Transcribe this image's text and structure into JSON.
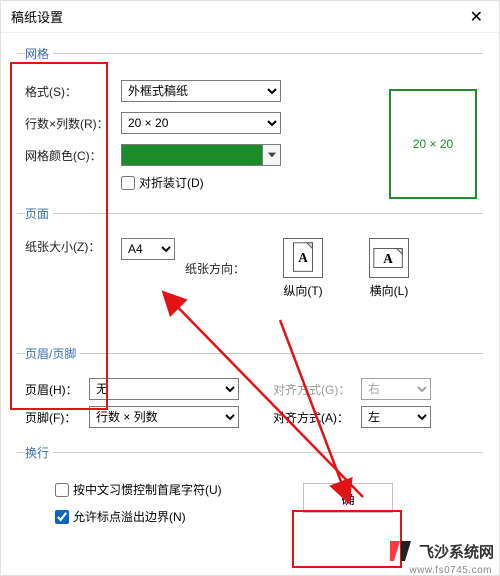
{
  "window": {
    "title": "稿纸设置",
    "close_icon_name": "close"
  },
  "groups": {
    "grid": "网格",
    "page": "页面",
    "header_footer": "页眉/页脚",
    "wrap": "换行"
  },
  "grid": {
    "format_label": "格式(S)：",
    "format_value": "外框式稿纸",
    "rowscols_label": "行数×列数(R)：",
    "rowscols_value": "20 × 20",
    "color_label": "网格颜色(C)：",
    "color_hex": "#1c8b2a",
    "fold_label": "对折装订(D)",
    "fold_checked": false,
    "preview_text": "20 × 20"
  },
  "page": {
    "size_label": "纸张大小(Z)：",
    "size_value": "A4",
    "orient_label": "纸张方向：",
    "portrait_label": "纵向(T)",
    "landscape_label": "横向(L)"
  },
  "hf": {
    "header_label": "页眉(H)：",
    "header_value": "无",
    "footer_label": "页脚(F)：",
    "footer_value": "行数 × 列数",
    "align_label_disabled": "对齐方式(G)：",
    "align_value_disabled": "右",
    "align_label": "对齐方式(A)：",
    "align_value": "左"
  },
  "wrap": {
    "cjk_label": "按中文习惯控制首尾字符(U)",
    "cjk_checked": false,
    "overflow_label": "允许标点溢出边界(N)",
    "overflow_checked": true
  },
  "footer": {
    "confirm_label": "确"
  },
  "watermark": {
    "name": "飞沙系统网",
    "url": "www.fs0745.com"
  }
}
